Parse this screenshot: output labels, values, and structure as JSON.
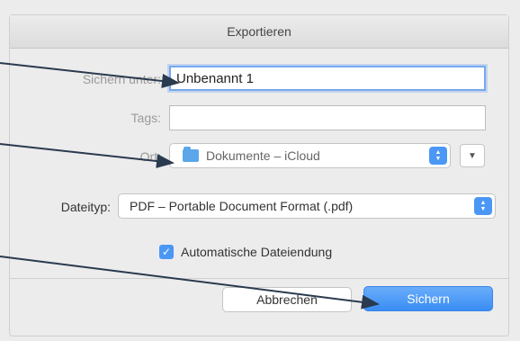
{
  "dialog": {
    "title": "Exportieren",
    "save_as": {
      "label": "Sichern unter:",
      "value": "Unbenannt 1"
    },
    "tags": {
      "label": "Tags:",
      "value": ""
    },
    "location": {
      "label": "Ort:",
      "value": "Dokumente – iCloud",
      "icon": "folder-icon"
    },
    "filetype": {
      "label": "Dateityp:",
      "value": "PDF – Portable Document Format (.pdf)"
    },
    "auto_extension": {
      "label": "Automatische Dateiendung",
      "checked": true
    },
    "cancel_label": "Abbrechen",
    "save_label": "Sichern"
  },
  "colors": {
    "accent": "#4b97f5",
    "arrow": "#2a3a4f"
  }
}
